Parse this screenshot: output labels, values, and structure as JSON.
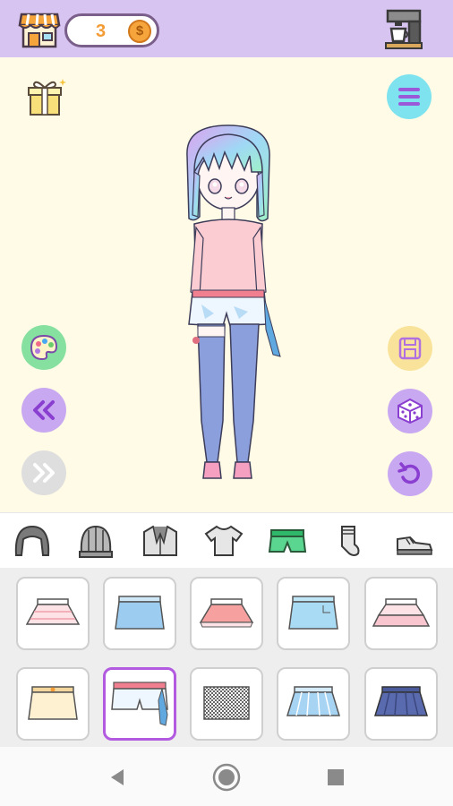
{
  "header": {
    "coin_count": "3",
    "coin_symbol": "$"
  },
  "icons": {
    "shop": "shop-icon",
    "coffee_machine": "coffee-machine-icon",
    "gift": "gift-icon",
    "menu": "menu-icon",
    "palette": "palette-icon",
    "save": "save-icon",
    "undo_all": "rewind-icon",
    "redo_all": "fast-forward-icon",
    "random": "dice-icon",
    "reset": "reset-icon"
  },
  "categories": [
    {
      "name": "hair",
      "selected": false
    },
    {
      "name": "hat",
      "selected": false
    },
    {
      "name": "jacket",
      "selected": false
    },
    {
      "name": "top",
      "selected": false
    },
    {
      "name": "bottoms",
      "selected": true
    },
    {
      "name": "socks",
      "selected": false
    },
    {
      "name": "shoes",
      "selected": false
    }
  ],
  "items": [
    {
      "name": "pink-frill-skirt",
      "selected": false
    },
    {
      "name": "blue-mini-skirt",
      "selected": false
    },
    {
      "name": "coral-frill-skirt",
      "selected": false
    },
    {
      "name": "denim-skirt",
      "selected": false
    },
    {
      "name": "pink-ruffle-skirt",
      "selected": false
    },
    {
      "name": "beige-skirt",
      "selected": false
    },
    {
      "name": "ribbon-shorts",
      "selected": true
    },
    {
      "name": "checkered-skirt",
      "selected": false
    },
    {
      "name": "pleated-blue-skirt",
      "selected": false
    },
    {
      "name": "navy-pleated-skirt",
      "selected": false
    }
  ],
  "colors": {
    "header": "#d8c4f1",
    "stage": "#fffbe6",
    "accent_purple": "#c9a8f2",
    "accent_cyan": "#7ee3ef",
    "accent_green": "#86e0a0",
    "accent_yellow": "#f9e39a",
    "selected_border": "#b25be0"
  }
}
